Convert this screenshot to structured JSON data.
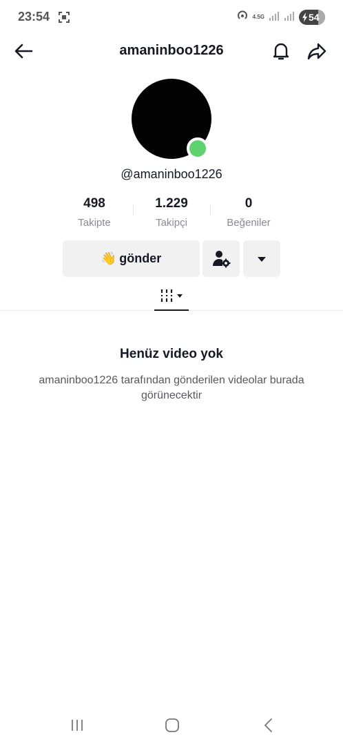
{
  "status_bar": {
    "time": "23:54",
    "network_type": "4.5G",
    "battery_level": "54",
    "icons": [
      "screenshot-icon",
      "hotspot-icon",
      "signal-icon",
      "signal-icon",
      "battery-charging-icon"
    ]
  },
  "header": {
    "title": "amaninboo1226",
    "icons": [
      "back-arrow-icon",
      "bell-icon",
      "share-icon"
    ]
  },
  "profile": {
    "handle": "@amaninboo1226",
    "online_status_color": "#5dd26f",
    "stats": [
      {
        "value": "498",
        "label": "Takipte"
      },
      {
        "value": "1.229",
        "label": "Takipçi"
      },
      {
        "value": "0",
        "label": "Beğeniler"
      }
    ]
  },
  "actions": {
    "send_emoji": "👋",
    "send_label": "gönder",
    "icons": [
      "user-settings-icon",
      "caret-down-icon"
    ]
  },
  "tabs": {
    "icons": [
      "video-grid-icon",
      "caret-down-icon"
    ]
  },
  "empty_state": {
    "title": "Henüz video yok",
    "description": "amaninboo1226 tarafından gönderilen videolar burada görünecektir"
  },
  "navbar": {
    "icons": [
      "recents-icon",
      "home-icon",
      "back-icon"
    ]
  }
}
